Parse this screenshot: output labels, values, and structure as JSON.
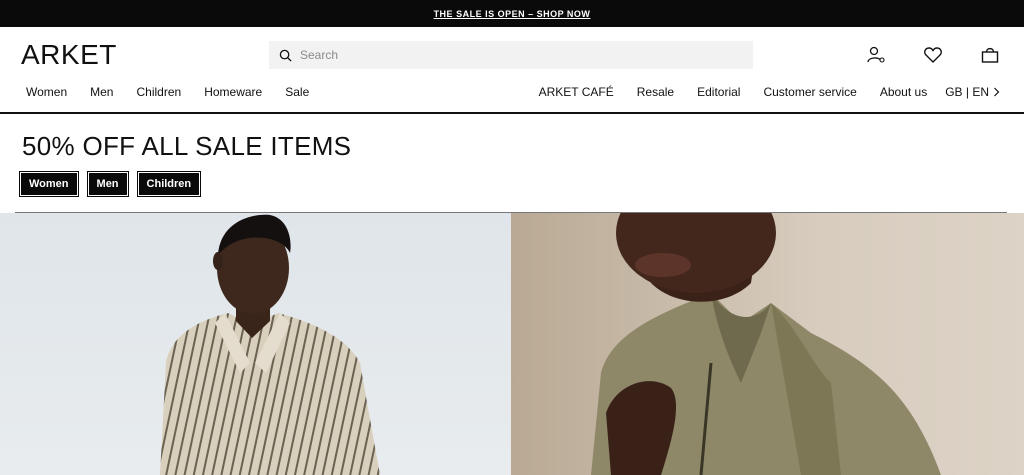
{
  "announcement": {
    "text": "THE SALE IS OPEN – SHOP NOW"
  },
  "header": {
    "logo": "ARKET",
    "search": {
      "placeholder": "Search",
      "value": ""
    },
    "icons": [
      "account-icon",
      "heart-icon",
      "bag-icon"
    ]
  },
  "nav": {
    "left": [
      "Women",
      "Men",
      "Children",
      "Homeware",
      "Sale"
    ],
    "right": [
      "ARKET CAFÉ",
      "Resale",
      "Editorial",
      "Customer service",
      "About us"
    ],
    "locale": "GB | EN"
  },
  "main": {
    "headline": "50% OFF ALL SALE ITEMS",
    "chips": [
      "Women",
      "Men",
      "Children"
    ]
  },
  "colors": {
    "bar": "#0a0a0a",
    "text": "#111111"
  }
}
